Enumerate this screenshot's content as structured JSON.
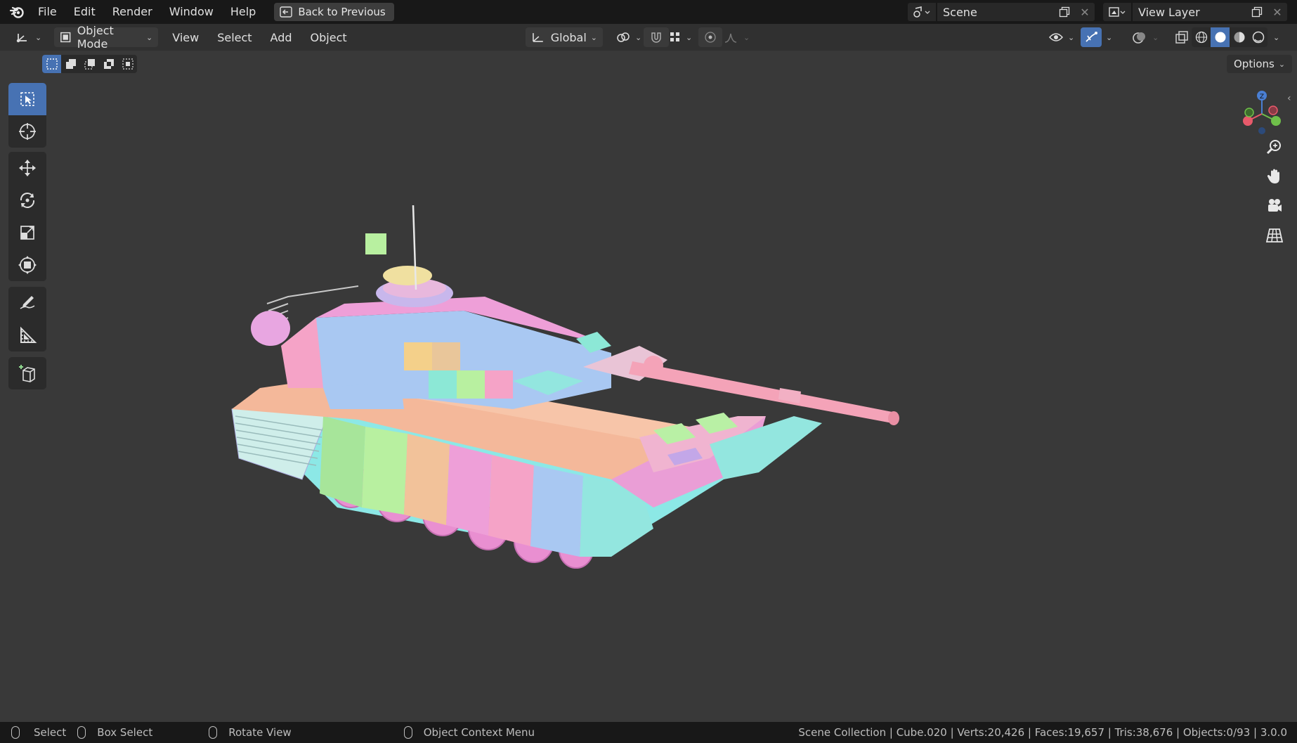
{
  "menu": {
    "items": [
      "File",
      "Edit",
      "Render",
      "Window",
      "Help"
    ],
    "back_button": "Back to Previous"
  },
  "scene": {
    "name": "Scene"
  },
  "view_layer": {
    "name": "View Layer"
  },
  "header": {
    "mode": "Object Mode",
    "menus": [
      "View",
      "Select",
      "Add",
      "Object"
    ],
    "orientation": "Global",
    "options_label": "Options"
  },
  "status": {
    "select": "Select",
    "box_select": "Box Select",
    "rotate_view": "Rotate View",
    "context_menu": "Object Context Menu",
    "stats": "Scene Collection | Cube.020 | Verts:20,426 | Faces:19,657 | Tris:38,676 | Objects:0/93 | 3.0.0"
  },
  "colors": {
    "accent": "#4772b3",
    "viewport_bg": "#393939",
    "header_bg": "#303030",
    "topbar_bg": "#181818"
  }
}
